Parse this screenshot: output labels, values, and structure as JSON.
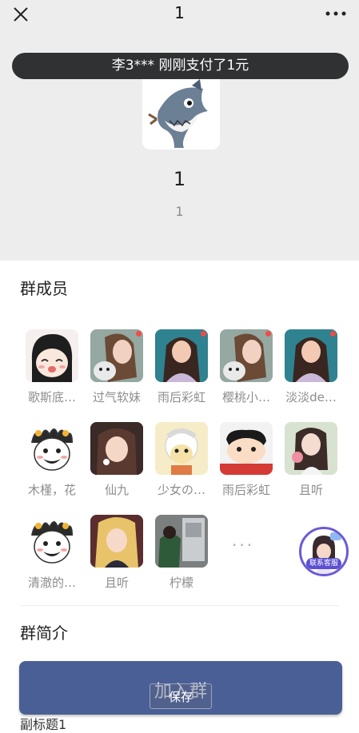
{
  "nav": {
    "title": "1"
  },
  "toast": "李3*** 刚刚支付了1元",
  "group": {
    "name": "1",
    "id": "1"
  },
  "members_title": "群成员",
  "members": [
    {
      "name": "歌斯底…"
    },
    {
      "name": "过气软妹"
    },
    {
      "name": "雨后彩虹"
    },
    {
      "name": "樱桃小…"
    },
    {
      "name": "淡淡de…"
    },
    {
      "name": "木槿，花"
    },
    {
      "name": "仙九"
    },
    {
      "name": "少女の…"
    },
    {
      "name": "雨后彩虹"
    },
    {
      "name": "且听"
    },
    {
      "name": "清澈的…"
    },
    {
      "name": "且听"
    },
    {
      "name": "柠檬"
    }
  ],
  "more_members": "···",
  "service_label": "联系客服",
  "intro_title": "群简介",
  "join_button": "加入群",
  "save_tooltip": "保存",
  "bottom_peek": "副标题1",
  "icons": {
    "close": "close-icon",
    "more": "more-icon",
    "service": "customer-service-icon"
  },
  "colors": {
    "join_button": "#4a5f95",
    "toast_bg": "#2f3133",
    "header_bg": "#ededed",
    "service_ring": "#6b5bd6"
  }
}
